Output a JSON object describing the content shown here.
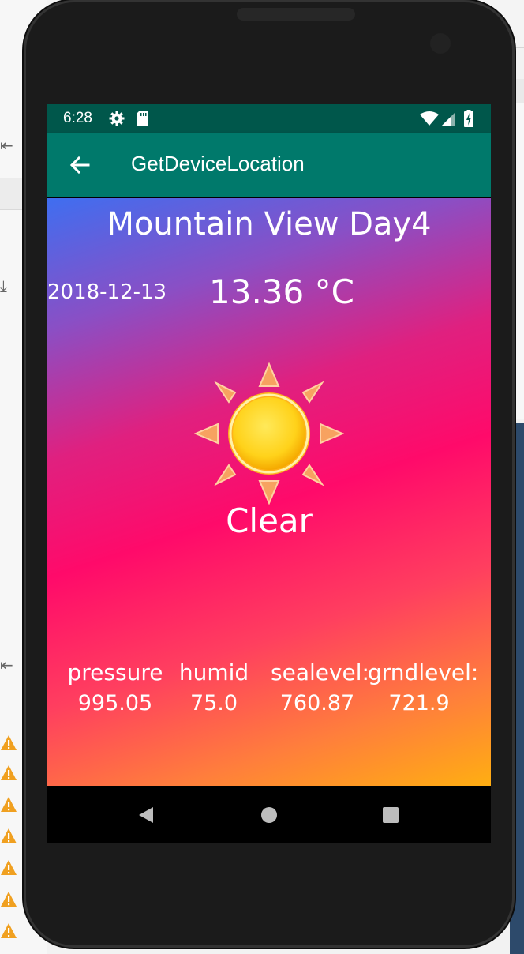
{
  "status_bar": {
    "time": "6:28",
    "icons": [
      "settings-gear-icon",
      "sd-card-icon",
      "wifi-icon",
      "cell-signal-icon",
      "battery-charging-icon"
    ]
  },
  "app_bar": {
    "back_icon": "arrow-back-icon",
    "title": "GetDeviceLocation"
  },
  "weather": {
    "city": "Mountain View Day4",
    "date": "2018-12-13",
    "temperature": "13.36 °C",
    "condition": "Clear",
    "condition_icon": "sun-icon",
    "metrics": [
      {
        "label": "pressure",
        "value": "995.05"
      },
      {
        "label": "humid",
        "value": "75.0"
      },
      {
        "label": "sealevel:",
        "value": "760.87"
      },
      {
        "label": "grndlevel:",
        "value": "721.9"
      }
    ]
  },
  "nav_bar": {
    "buttons": [
      "back-triangle-icon",
      "home-circle-icon",
      "recents-square-icon"
    ]
  },
  "colors": {
    "status_bar": "#00574b",
    "app_bar": "#00796b",
    "gradient_top": "#3f6ef0",
    "gradient_middle": "#ff0a6a",
    "gradient_bottom": "#ffae12"
  }
}
